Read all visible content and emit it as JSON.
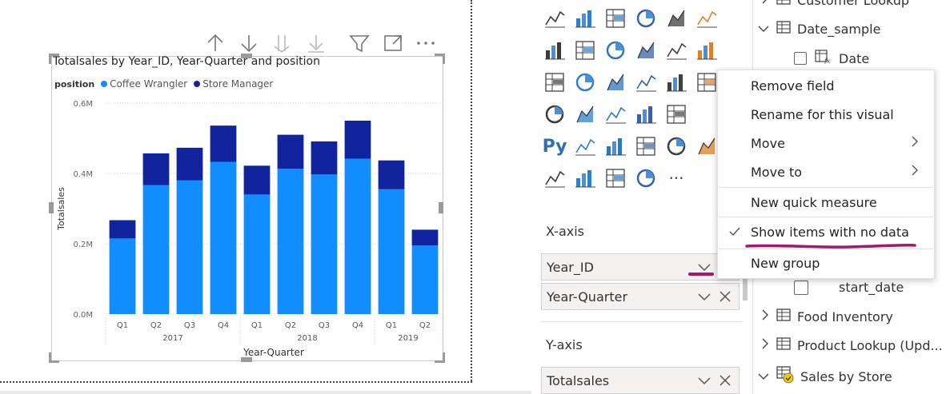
{
  "visual_header": {
    "icons": [
      "arrow-up-icon",
      "arrow-down-icon",
      "double-arrow-down-icon",
      "expand-all-down-icon",
      "filter-icon",
      "focus-mode-icon",
      "more-options-icon"
    ]
  },
  "chart_data": {
    "type": "bar",
    "stacked": true,
    "title": "Totalsales by Year_ID, Year-Quarter and position",
    "legend_title": "position",
    "legend_position": "top-left",
    "categories": [
      "Q1",
      "Q2",
      "Q3",
      "Q4",
      "Q1",
      "Q2",
      "Q3",
      "Q4",
      "Q1",
      "Q2"
    ],
    "groups": [
      {
        "label": "2017",
        "span": 4
      },
      {
        "label": "2018",
        "span": 4
      },
      {
        "label": "2019",
        "span": 2
      }
    ],
    "series": [
      {
        "name": "Coffee Wrangler",
        "color": "#118dff",
        "values": [
          0.215,
          0.367,
          0.38,
          0.433,
          0.34,
          0.413,
          0.397,
          0.442,
          0.355,
          0.195
        ]
      },
      {
        "name": "Store Manager",
        "color": "#12239e",
        "values": [
          0.052,
          0.09,
          0.093,
          0.103,
          0.082,
          0.097,
          0.094,
          0.108,
          0.082,
          0.045
        ]
      }
    ],
    "xlabel": "Year-Quarter",
    "ylabel": "Totalsales",
    "ylim": [
      0,
      0.6
    ],
    "yticks": [
      "0.0M",
      "0.2M",
      "0.4M",
      "0.6M"
    ],
    "ytick_values": [
      0,
      0.2,
      0.4,
      0.6
    ],
    "grid": true
  },
  "viz_pane": {
    "icons": [
      "line-chart-icon",
      "area-chart-icon",
      "stacked-area-icon",
      "line-clustered-column-icon",
      "line-stacked-column-icon",
      "ribbon-chart-icon",
      "waterfall-chart-icon",
      "funnel-icon",
      "scatter-chart-icon",
      "pie-chart-icon",
      "donut-chart-icon",
      "treemap-icon",
      "map-icon",
      "filled-map-icon",
      "shape-map-icon",
      "azure-map-icon",
      "gauge-icon",
      "card-icon",
      "kpi-icon",
      "multi-row-card-icon",
      "slicer-icon",
      "table-icon",
      "matrix-icon",
      "",
      "python-visual-icon",
      "key-influencers-icon",
      "decomposition-tree-icon",
      "qa-icon",
      "smart-narrative-icon",
      "paginated-report-icon",
      "report-icon",
      "arcgis-icon",
      "power-apps-icon",
      "power-automate-icon",
      "more-visuals-icon",
      ""
    ],
    "python_label": "Py",
    "more_label": "···",
    "xaxis_label": "X-axis",
    "xaxis_fields": [
      "Year_ID",
      "Year-Quarter"
    ],
    "yaxis_label": "Y-axis",
    "yaxis_fields": [
      "Totalsales"
    ]
  },
  "fields_pane": {
    "items": [
      {
        "label": "Customer Lookup",
        "expanded": false
      },
      {
        "label": "Date_sample",
        "expanded": true
      },
      {
        "label": "Date",
        "child": true
      },
      {
        "label": "start_date",
        "child": true
      },
      {
        "label": "Food Inventory",
        "expanded": false
      },
      {
        "label": "Product Lookup (Upd...",
        "expanded": false
      },
      {
        "label": "Sales by Store",
        "expanded": true
      }
    ]
  },
  "context_menu": {
    "items": [
      {
        "label": "Remove field"
      },
      {
        "label": "Rename for this visual"
      },
      {
        "label": "Move",
        "submenu": true
      },
      {
        "label": "Move to",
        "submenu": true
      },
      {
        "label": "New quick measure"
      },
      {
        "label": "Show items with no data",
        "checked": true
      },
      {
        "label": "New group"
      }
    ],
    "annotation_color": "#a0196e"
  }
}
